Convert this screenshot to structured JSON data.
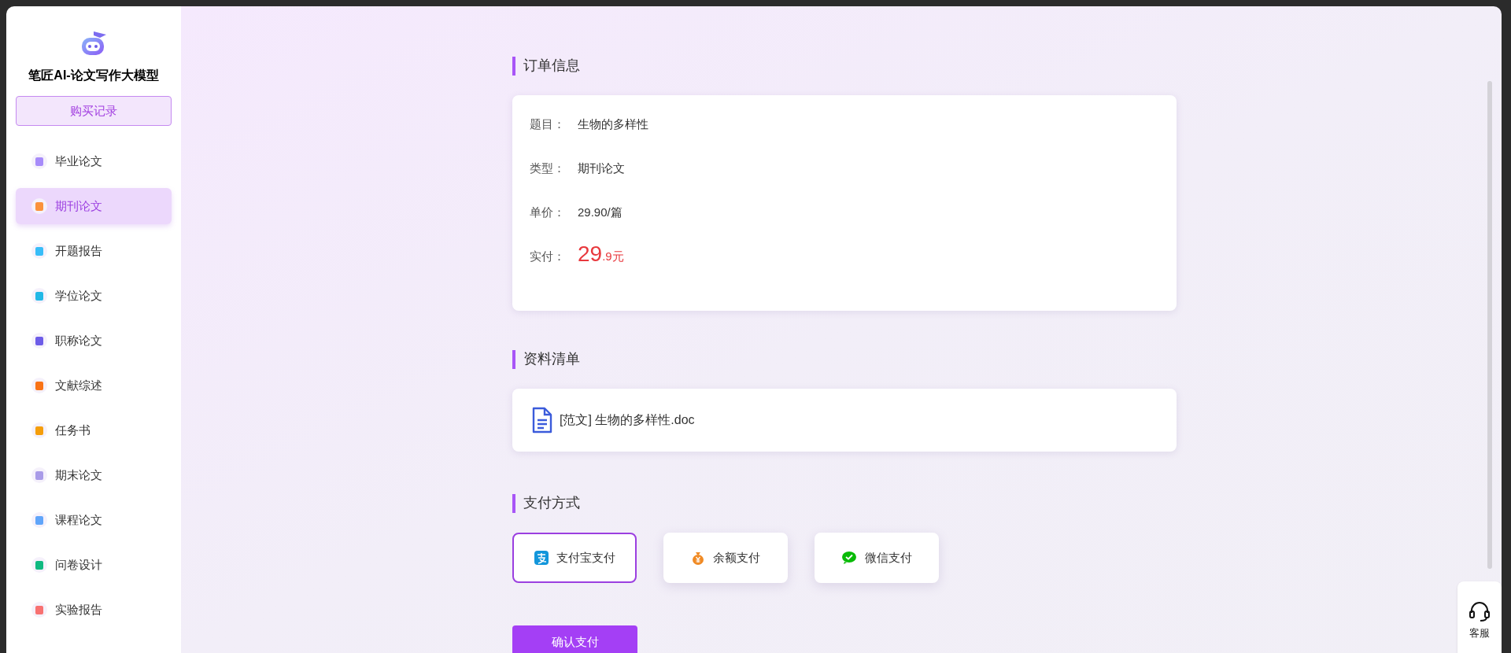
{
  "sidebar": {
    "title": "笔匠AI-论文写作大模型",
    "purchase_button": "购买记录",
    "items": [
      {
        "label": "毕业论文",
        "selected": false,
        "color": "#a78bfa"
      },
      {
        "label": "期刊论文",
        "selected": true,
        "color": "#fb923c"
      },
      {
        "label": "开题报告",
        "selected": false,
        "color": "#38bdf8"
      },
      {
        "label": "学位论文",
        "selected": false,
        "color": "#22b8e6"
      },
      {
        "label": "职称论文",
        "selected": false,
        "color": "#6d5ce8"
      },
      {
        "label": "文献综述",
        "selected": false,
        "color": "#f97316"
      },
      {
        "label": "任务书",
        "selected": false,
        "color": "#f59e0b"
      },
      {
        "label": "期末论文",
        "selected": false,
        "color": "#a99be8"
      },
      {
        "label": "课程论文",
        "selected": false,
        "color": "#60a5fa"
      },
      {
        "label": "问卷设计",
        "selected": false,
        "color": "#10b981"
      },
      {
        "label": "实验报告",
        "selected": false,
        "color": "#f87171"
      }
    ]
  },
  "order": {
    "heading": "订单信息",
    "rows": [
      {
        "kind": "text",
        "label": "题目：",
        "value": "生物的多样性"
      },
      {
        "kind": "text",
        "label": "类型：",
        "value": "期刊论文"
      },
      {
        "kind": "text",
        "label": "单价：",
        "value": "29.90/篇"
      },
      {
        "kind": "price",
        "label": "实付：",
        "value": "29",
        "fraction": ".9元"
      }
    ]
  },
  "materials": {
    "heading": "资料清单",
    "files": [
      "[范文] 生物的多样性.doc"
    ]
  },
  "payment": {
    "heading": "支付方式",
    "methods": [
      {
        "kind": "alipay",
        "label": "支付宝支付",
        "selected": true
      },
      {
        "kind": "balance",
        "label": "余额支付",
        "selected": false
      },
      {
        "kind": "wechat",
        "label": "微信支付",
        "selected": false
      }
    ],
    "confirm_button": "确认支付"
  },
  "support_button": "客服"
}
